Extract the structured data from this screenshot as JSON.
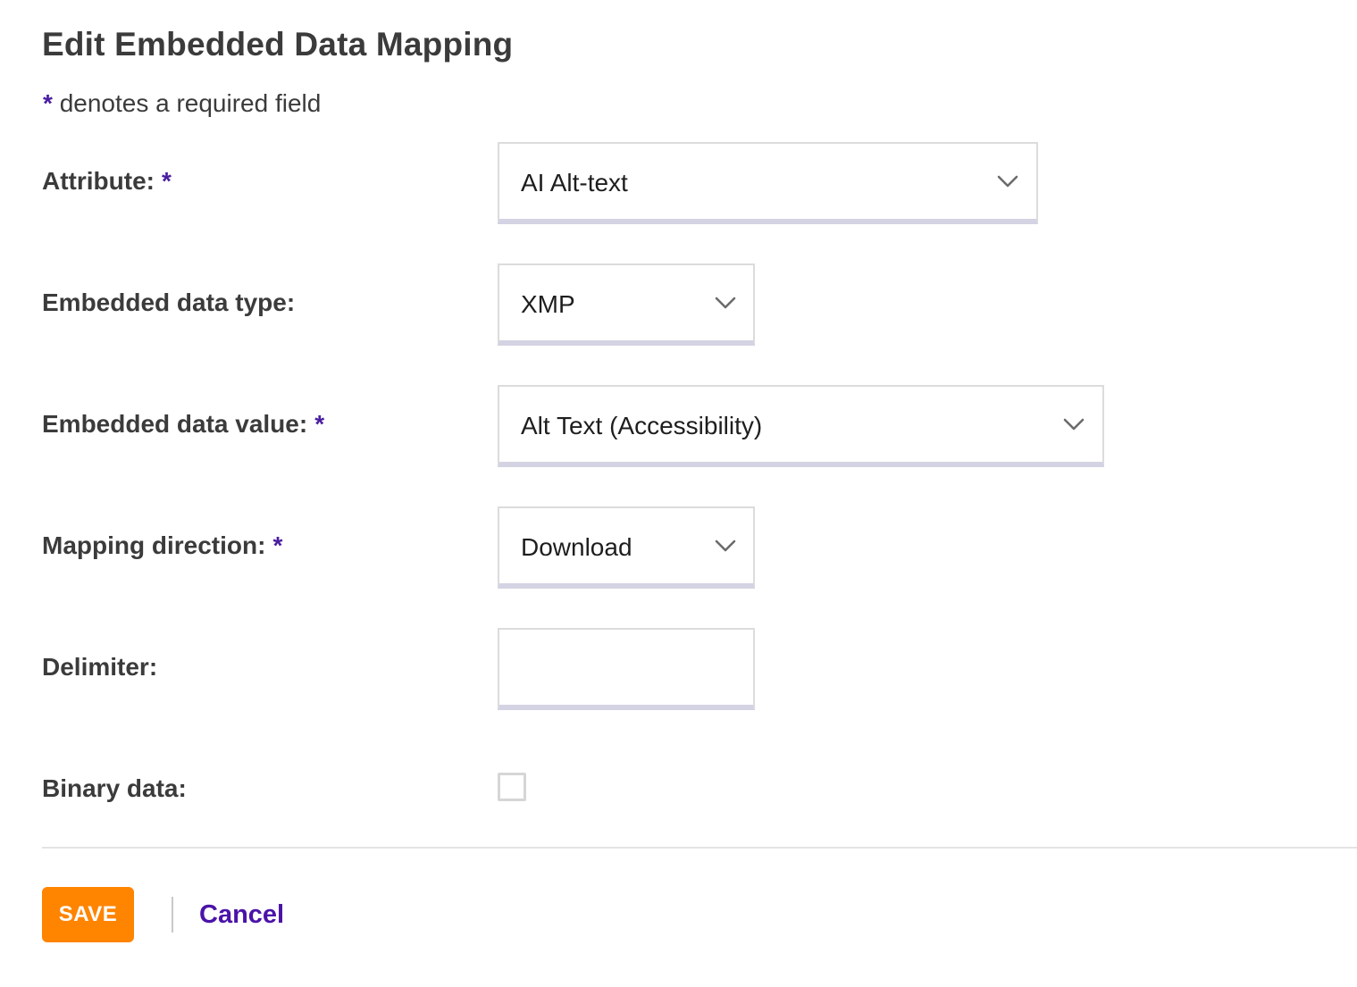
{
  "page": {
    "title": "Edit Embedded Data Mapping",
    "required_mark": "*",
    "required_note": "denotes a required field"
  },
  "form": {
    "attribute": {
      "label": "Attribute:",
      "required": true,
      "value": "AI Alt-text"
    },
    "embedded_data_type": {
      "label": "Embedded data type:",
      "required": false,
      "value": "XMP"
    },
    "embedded_data_value": {
      "label": "Embedded data value:",
      "required": true,
      "value": "Alt Text (Accessibility)"
    },
    "mapping_direction": {
      "label": "Mapping direction:",
      "required": true,
      "value": "Download"
    },
    "delimiter": {
      "label": "Delimiter:",
      "required": false,
      "value": ""
    },
    "binary_data": {
      "label": "Binary data:",
      "checked": false
    }
  },
  "actions": {
    "save_label": "SAVE",
    "cancel_label": "Cancel"
  },
  "colors": {
    "accent": "#ff8400",
    "link": "#4a13a8",
    "required_mark": "#4a1ea0",
    "field_underline": "#d4d3e3"
  },
  "icons": {
    "select_chevron": "chevron-down-icon"
  }
}
